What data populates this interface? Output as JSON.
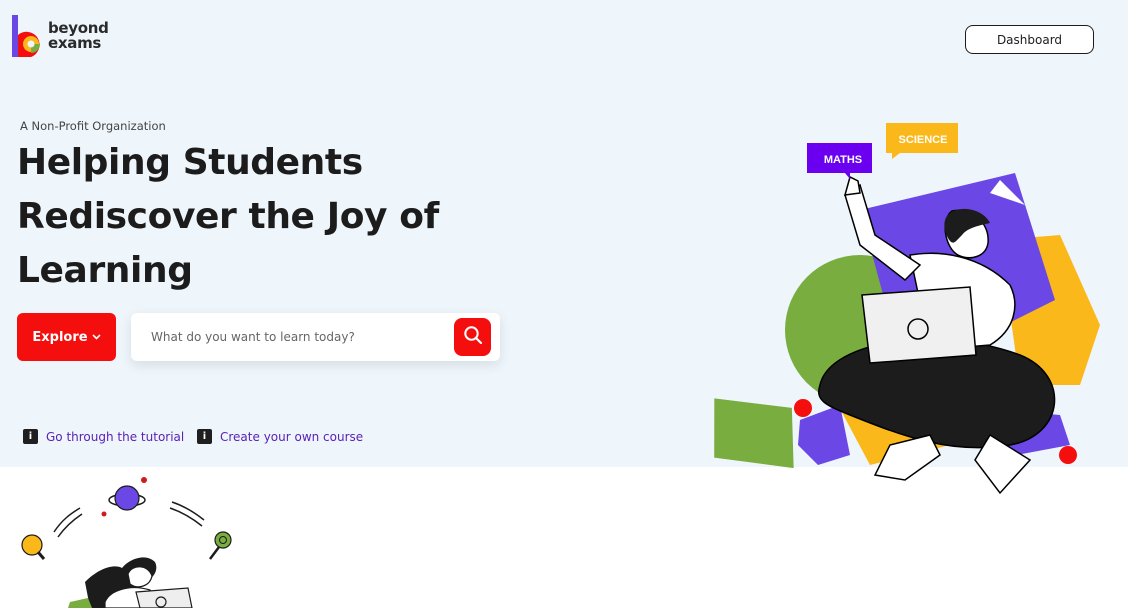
{
  "brand": {
    "name_line1": "beyond",
    "name_line2": "exams",
    "colors": {
      "red": "#f50e0e",
      "yellow": "#fbb81a",
      "purple": "#6b48e6",
      "green": "#7aad3f"
    }
  },
  "header": {
    "dashboard_label": "Dashboard"
  },
  "hero": {
    "eyebrow": "A Non-Profit Organization",
    "headline": "Helping Students Rediscover the Joy of Learning",
    "explore_label": "Explore",
    "search": {
      "placeholder": "What do you want to learn today?",
      "icon": "search-icon"
    },
    "links": [
      {
        "icon_text": "i",
        "label": "Go through the tutorial"
      },
      {
        "icon_text": "i",
        "label": "Create your own course"
      }
    ],
    "illustration": {
      "tag_maths": "MATHS",
      "tag_science": "SCIENCE"
    }
  }
}
